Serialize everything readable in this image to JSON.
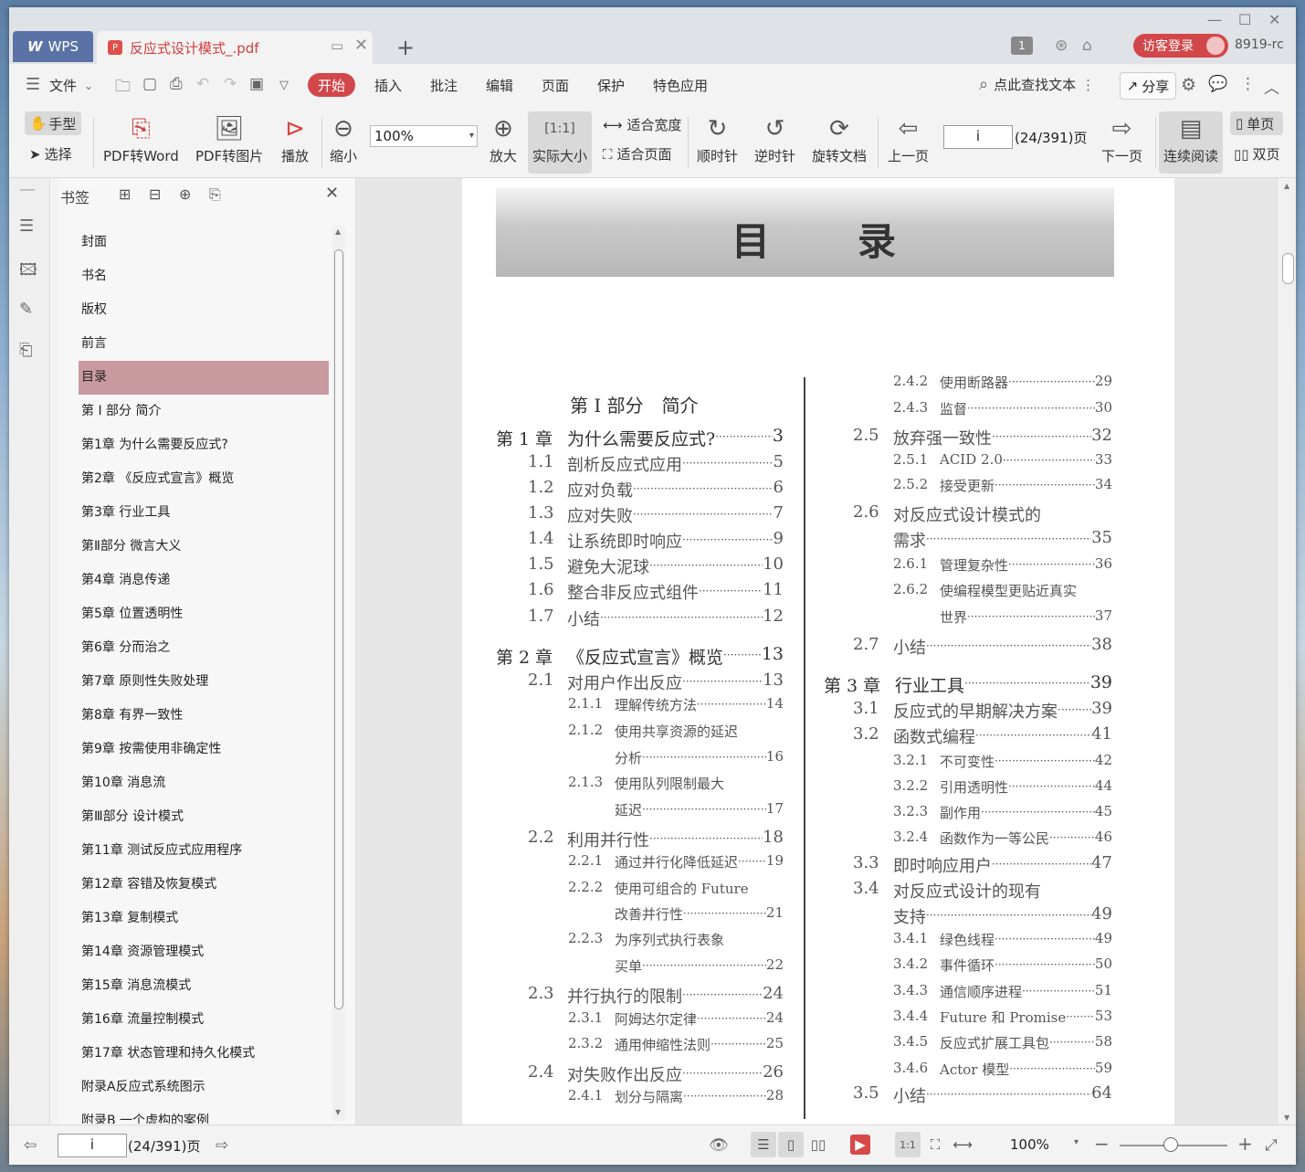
{
  "titlebar": {
    "app_tab": "WPS",
    "doc_tab": "反应式设计模式_.pdf",
    "badge": "1",
    "login_label": "访客登录",
    "user_label": "8919-rc"
  },
  "menu": {
    "file": "文件",
    "start": "开始",
    "items": [
      "插入",
      "批注",
      "编辑",
      "页面",
      "保护",
      "特色应用"
    ],
    "search": "点此查找文本",
    "share": "分享"
  },
  "toolbar": {
    "hand": "手型",
    "select": "选择",
    "pdf_word": "PDF转Word",
    "pdf_image": "PDF转图片",
    "play": "播放",
    "zoom_out": "缩小",
    "zoom_value": "100%",
    "zoom_in": "放大",
    "actual_size": "实际大小",
    "fit_width": "适合宽度",
    "fit_page": "适合页面",
    "cw": "顺时针",
    "ccw": "逆时针",
    "rotate_doc": "旋转文档",
    "prev": "上一页",
    "page_value": "i",
    "page_count": "(24/391)页",
    "next": "下一页",
    "continuous": "连续阅读",
    "single": "单页",
    "double": "双页"
  },
  "bookmarks": {
    "title": "书签",
    "items": [
      {
        "label": "封面",
        "arrow": false
      },
      {
        "label": "书名",
        "arrow": false
      },
      {
        "label": "版权",
        "arrow": false
      },
      {
        "label": "前言",
        "arrow": false
      },
      {
        "label": "目录",
        "arrow": false,
        "selected": true
      },
      {
        "label": "第 I 部分 简介",
        "arrow": false
      },
      {
        "label": "第1章 为什么需要反应式?",
        "arrow": true
      },
      {
        "label": "第2章 《反应式宣言》概览",
        "arrow": true
      },
      {
        "label": "第3章 行业工具",
        "arrow": true
      },
      {
        "label": "第Ⅱ部分 微言大义",
        "arrow": false
      },
      {
        "label": "第4章 消息传递",
        "arrow": true
      },
      {
        "label": "第5章 位置透明性",
        "arrow": true
      },
      {
        "label": "第6章 分而治之",
        "arrow": true
      },
      {
        "label": "第7章 原则性失败处理",
        "arrow": true
      },
      {
        "label": "第8章 有界一致性",
        "arrow": true
      },
      {
        "label": "第9章 按需使用非确定性",
        "arrow": true
      },
      {
        "label": "第10章 消息流",
        "arrow": true
      },
      {
        "label": "第Ⅲ部分 设计模式",
        "arrow": false
      },
      {
        "label": "第11章 测试反应式应用程序",
        "arrow": true
      },
      {
        "label": "第12章 容错及恢复模式",
        "arrow": true
      },
      {
        "label": "第13章 复制模式",
        "arrow": true
      },
      {
        "label": "第14章 资源管理模式",
        "arrow": true
      },
      {
        "label": "第15章 消息流模式",
        "arrow": true
      },
      {
        "label": "第16章 流量控制模式",
        "arrow": true
      },
      {
        "label": "第17章 状态管理和持久化模式",
        "arrow": true
      },
      {
        "label": "附录A反应式系统图示",
        "arrow": false
      },
      {
        "label": "附录B 一个虚构的案例",
        "arrow": false
      }
    ]
  },
  "document": {
    "banner_left": "目",
    "banner_right": "录",
    "part_title": "第 I 部分　简介",
    "left_entries": [
      {
        "num": "第 1 章",
        "text": "为什么需要反应式?",
        "page": "3",
        "level": 0
      },
      {
        "num": "1.1",
        "text": "剖析反应式应用",
        "page": "5",
        "level": 1
      },
      {
        "num": "1.2",
        "text": "应对负载",
        "page": "6",
        "level": 1
      },
      {
        "num": "1.3",
        "text": "应对失败",
        "page": "7",
        "level": 1
      },
      {
        "num": "1.4",
        "text": "让系统即时响应",
        "page": "9",
        "level": 1
      },
      {
        "num": "1.5",
        "text": "避免大泥球",
        "page": "10",
        "level": 1
      },
      {
        "num": "1.6",
        "text": "整合非反应式组件",
        "page": "11",
        "level": 1
      },
      {
        "num": "1.7",
        "text": "小结",
        "page": "12",
        "level": 1
      },
      {
        "num": "第 2 章",
        "text": "《反应式宣言》概览",
        "page": "13",
        "level": 0
      },
      {
        "num": "2.1",
        "text": "对用户作出反应",
        "page": "13",
        "level": 1
      },
      {
        "num": "2.1.1",
        "text": "理解传统方法",
        "page": "14",
        "level": 2
      },
      {
        "num": "2.1.2",
        "text": "使用共享资源的延迟",
        "page": "",
        "level": 2
      },
      {
        "num": "",
        "text": "分析",
        "page": "16",
        "level": 3
      },
      {
        "num": "2.1.3",
        "text": "使用队列限制最大",
        "page": "",
        "level": 2
      },
      {
        "num": "",
        "text": "延迟",
        "page": "17",
        "level": 3
      },
      {
        "num": "2.2",
        "text": "利用并行性",
        "page": "18",
        "level": 1
      },
      {
        "num": "2.2.1",
        "text": "通过并行化降低延迟",
        "page": "19",
        "level": 2
      },
      {
        "num": "2.2.2",
        "text": "使用可组合的 Future",
        "page": "",
        "level": 2
      },
      {
        "num": "",
        "text": "改善并行性",
        "page": "21",
        "level": 3
      },
      {
        "num": "2.2.3",
        "text": "为序列式执行表象",
        "page": "",
        "level": 2
      },
      {
        "num": "",
        "text": "买单",
        "page": "22",
        "level": 3
      },
      {
        "num": "2.3",
        "text": "并行执行的限制",
        "page": "24",
        "level": 1
      },
      {
        "num": "2.3.1",
        "text": "阿姆达尔定律",
        "page": "24",
        "level": 2
      },
      {
        "num": "2.3.2",
        "text": "通用伸缩性法则",
        "page": "25",
        "level": 2
      },
      {
        "num": "2.4",
        "text": "对失败作出反应",
        "page": "26",
        "level": 1
      },
      {
        "num": "2.4.1",
        "text": "划分与隔离",
        "page": "28",
        "level": 2
      }
    ],
    "right_entries": [
      {
        "num": "2.4.2",
        "text": "使用断路器",
        "page": "29",
        "level": 2
      },
      {
        "num": "2.4.3",
        "text": "监督",
        "page": "30",
        "level": 2
      },
      {
        "num": "2.5",
        "text": "放弃强一致性",
        "page": "32",
        "level": 1
      },
      {
        "num": "2.5.1",
        "text": "ACID 2.0",
        "page": "33",
        "level": 2
      },
      {
        "num": "2.5.2",
        "text": "接受更新",
        "page": "34",
        "level": 2
      },
      {
        "num": "2.6",
        "text": "对反应式设计模式的",
        "page": "",
        "level": 1
      },
      {
        "num": "",
        "text": "需求",
        "page": "35",
        "level": 4
      },
      {
        "num": "2.6.1",
        "text": "管理复杂性",
        "page": "36",
        "level": 2
      },
      {
        "num": "2.6.2",
        "text": "使编程模型更贴近真实",
        "page": "",
        "level": 2
      },
      {
        "num": "",
        "text": "世界",
        "page": "37",
        "level": 3
      },
      {
        "num": "2.7",
        "text": "小结",
        "page": "38",
        "level": 1
      },
      {
        "num": "第 3 章",
        "text": "行业工具",
        "page": "39",
        "level": 0
      },
      {
        "num": "3.1",
        "text": "反应式的早期解决方案",
        "page": "39",
        "level": 1
      },
      {
        "num": "3.2",
        "text": "函数式编程",
        "page": "41",
        "level": 1
      },
      {
        "num": "3.2.1",
        "text": "不可变性",
        "page": "42",
        "level": 2
      },
      {
        "num": "3.2.2",
        "text": "引用透明性",
        "page": "44",
        "level": 2
      },
      {
        "num": "3.2.3",
        "text": "副作用",
        "page": "45",
        "level": 2
      },
      {
        "num": "3.2.4",
        "text": "函数作为一等公民",
        "page": "46",
        "level": 2
      },
      {
        "num": "3.3",
        "text": "即时响应用户",
        "page": "47",
        "level": 1
      },
      {
        "num": "3.4",
        "text": "对反应式设计的现有",
        "page": "",
        "level": 1
      },
      {
        "num": "",
        "text": "支持",
        "page": "49",
        "level": 4
      },
      {
        "num": "3.4.1",
        "text": "绿色线程",
        "page": "49",
        "level": 2
      },
      {
        "num": "3.4.2",
        "text": "事件循环",
        "page": "50",
        "level": 2
      },
      {
        "num": "3.4.3",
        "text": "通信顺序进程",
        "page": "51",
        "level": 2
      },
      {
        "num": "3.4.4",
        "text": "Future 和 Promise",
        "page": "53",
        "level": 2
      },
      {
        "num": "3.4.5",
        "text": "反应式扩展工具包",
        "page": "58",
        "level": 2
      },
      {
        "num": "3.4.6",
        "text": "Actor 模型",
        "page": "59",
        "level": 2
      },
      {
        "num": "3.5",
        "text": "小结",
        "page": "64",
        "level": 1
      }
    ]
  },
  "status": {
    "page_value": "i",
    "page_count": "(24/391)页",
    "zoom": "100%"
  }
}
